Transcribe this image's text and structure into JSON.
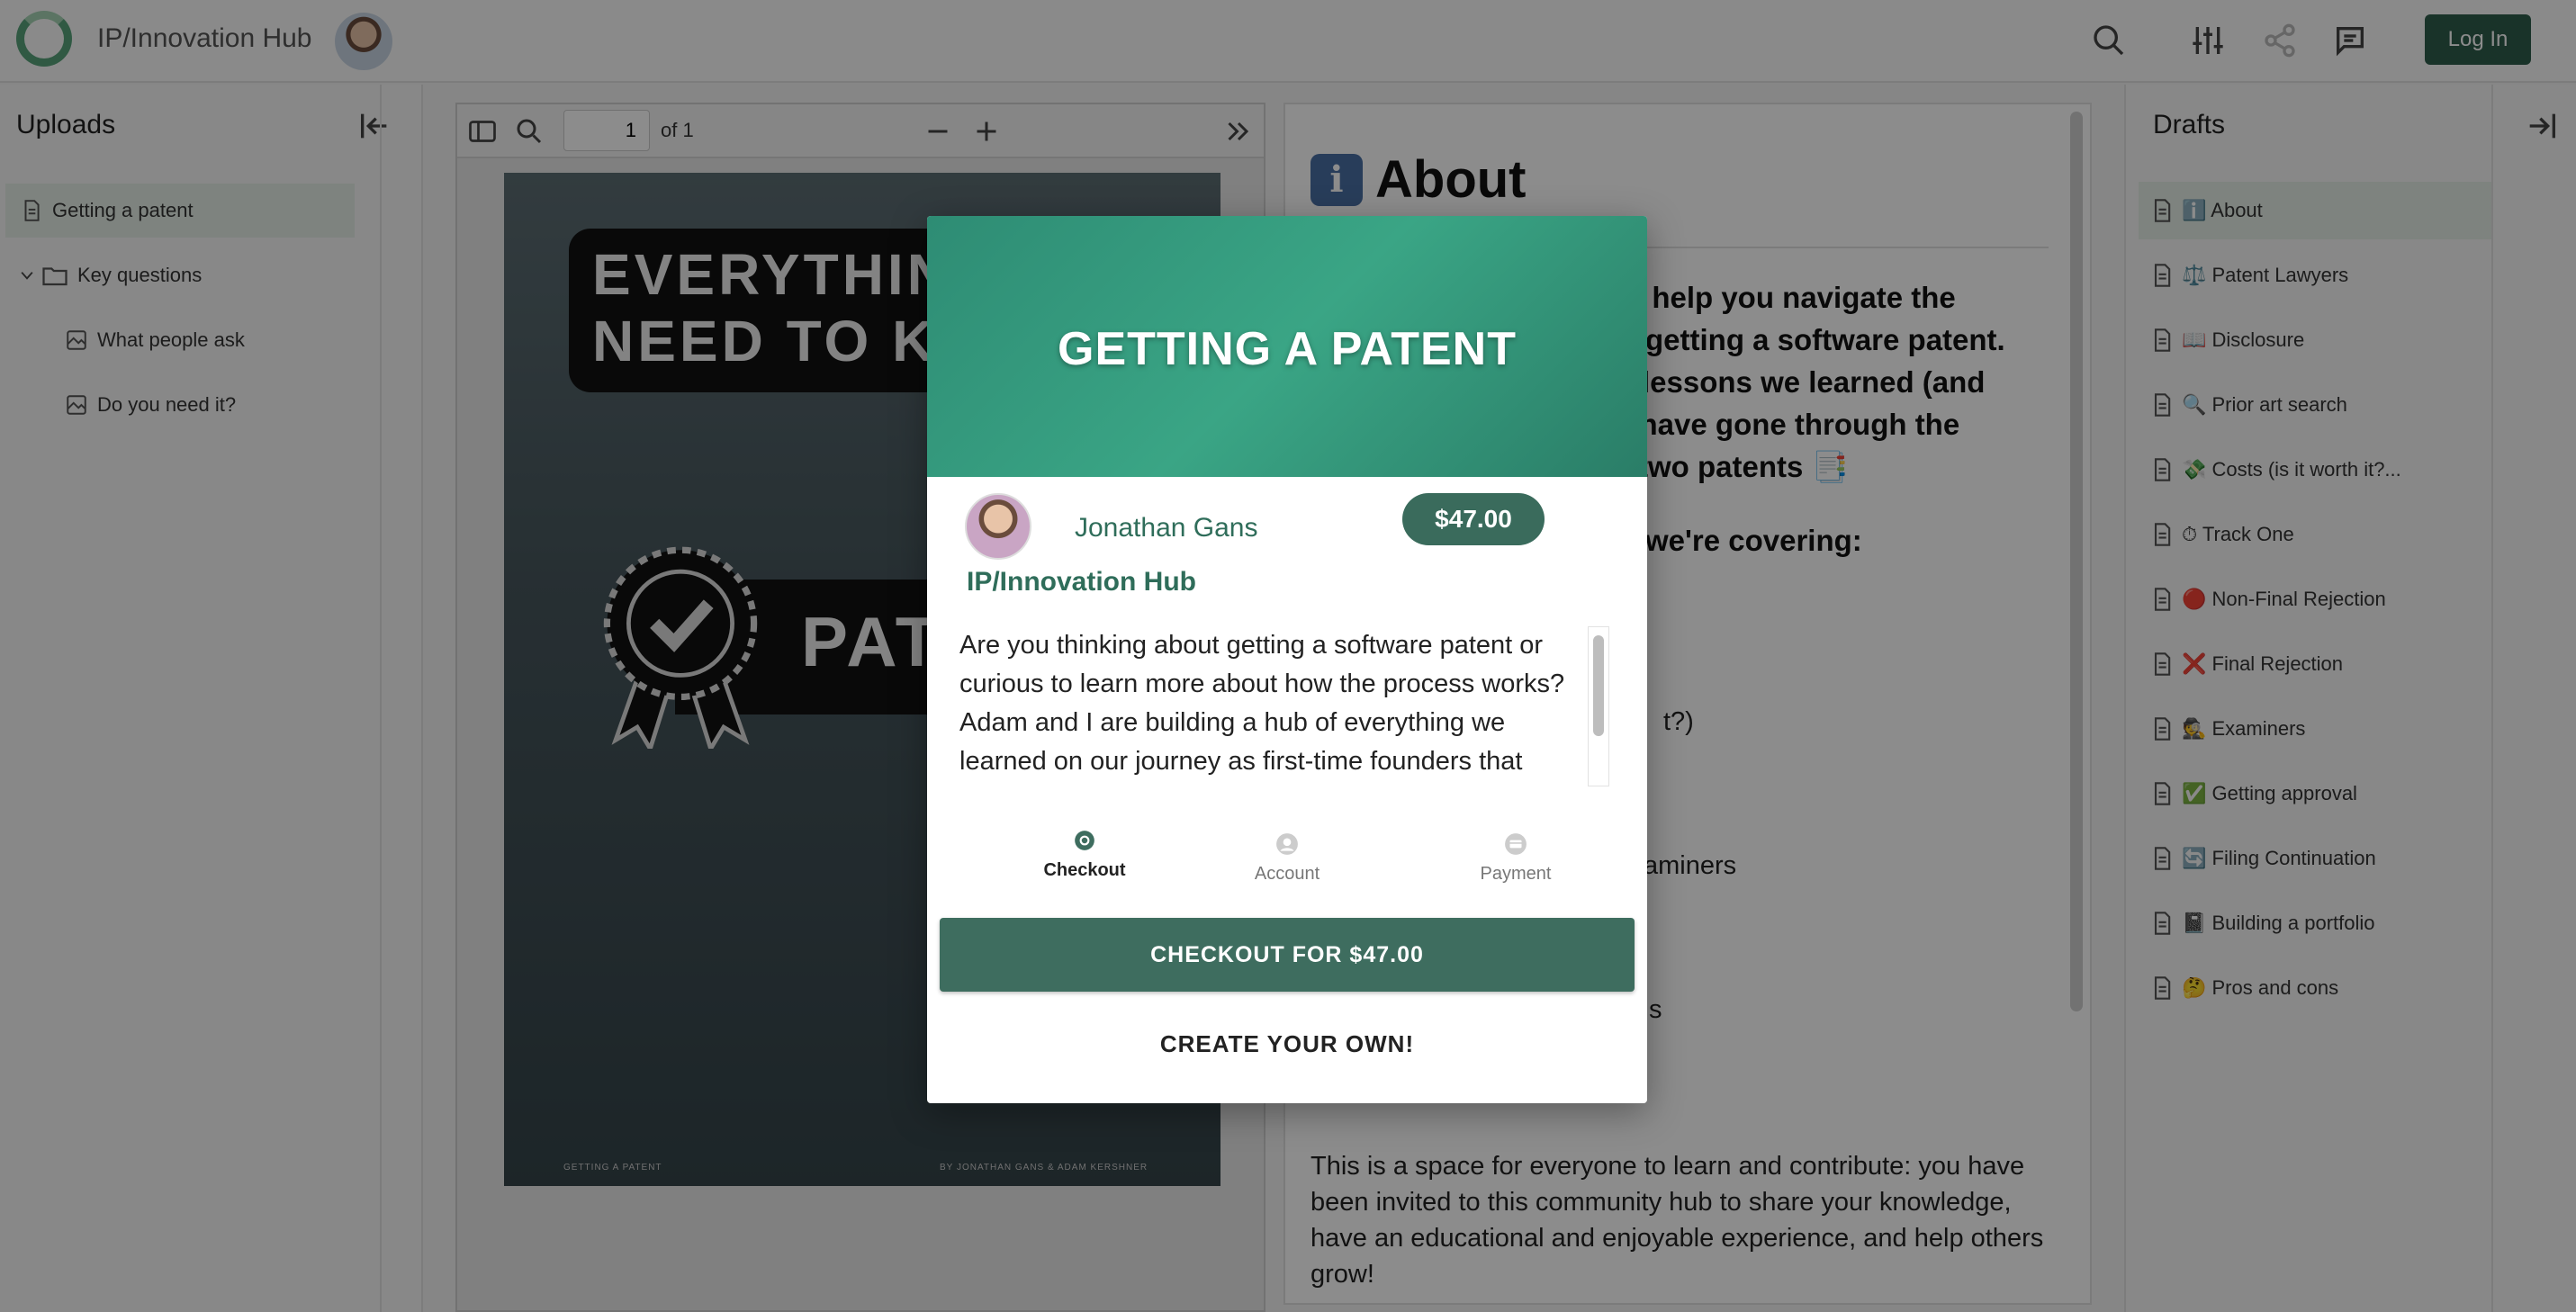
{
  "header": {
    "app_title": "IP/Innovation Hub",
    "login_label": "Log In",
    "icons": [
      "search-icon",
      "filter-sliders-icon",
      "share-icon",
      "chat-icon"
    ]
  },
  "uploads": {
    "title": "Uploads",
    "items": [
      {
        "label": "Getting a patent",
        "icon": "document-icon",
        "active": true
      },
      {
        "label": "Key questions",
        "icon": "folder-icon",
        "expanded": true
      },
      {
        "label": "What people ask",
        "icon": "image-icon"
      },
      {
        "label": "Do you need it?",
        "icon": "image-icon"
      }
    ]
  },
  "pdf": {
    "page_current": "1",
    "page_total_label": "of 1",
    "cover_line1": "EVERYTHING YOU",
    "cover_line2": "NEED TO KNOW",
    "cover_word": "PATENT",
    "footer_left": "GETTING A PATENT",
    "footer_right": "BY JONATHAN GANS & ADAM KERSHNER"
  },
  "article": {
    "title": "About",
    "bold_lines": [
      "o help you navigate the",
      "getting a software patent.",
      "lessons we learned (and",
      "e have gone through the",
      "two patents 📑",
      "we're covering:"
    ],
    "fragments": [
      "t?)",
      "aminers",
      "s"
    ],
    "closing": "This is a space for everyone to learn and contribute: you have been invited to this community hub to share your knowledge, have an educational and enjoyable experience, and help others grow!"
  },
  "drafts": {
    "title": "Drafts",
    "items": [
      {
        "label": "ℹ️ About",
        "active": true
      },
      {
        "label": "⚖️ Patent Lawyers"
      },
      {
        "label": "📖 Disclosure"
      },
      {
        "label": "🔍 Prior art search"
      },
      {
        "label": "💸 Costs (is it worth it?..."
      },
      {
        "label": "⏱ Track One"
      },
      {
        "label": "🔴 Non-Final Rejection"
      },
      {
        "label": "❌ Final Rejection"
      },
      {
        "label": "🕵️ Examiners"
      },
      {
        "label": "✅ Getting approval"
      },
      {
        "label": "🔄 Filing Continuation"
      },
      {
        "label": "📓 Building a portfolio"
      },
      {
        "label": "🤔 Pros and cons"
      }
    ]
  },
  "modal": {
    "banner_title": "GETTING A PATENT",
    "author": "Jonathan Gans",
    "price": "$47.00",
    "hub": "IP/Innovation Hub",
    "description": "Are you thinking about getting a software patent or curious to learn more about how the process works? Adam and I are building a hub of everything we learned on our journey as first-time founders that",
    "steps": [
      {
        "label": "Checkout",
        "active": true
      },
      {
        "label": "Account",
        "active": false
      },
      {
        "label": "Payment",
        "active": false
      }
    ],
    "checkout_label": "CHECKOUT FOR $47.00",
    "create_label": "CREATE YOUR OWN!"
  },
  "colors": {
    "brand_green": "#3e6d5f",
    "banner_green": "#3aa585",
    "active_row": "#e6efe8"
  }
}
